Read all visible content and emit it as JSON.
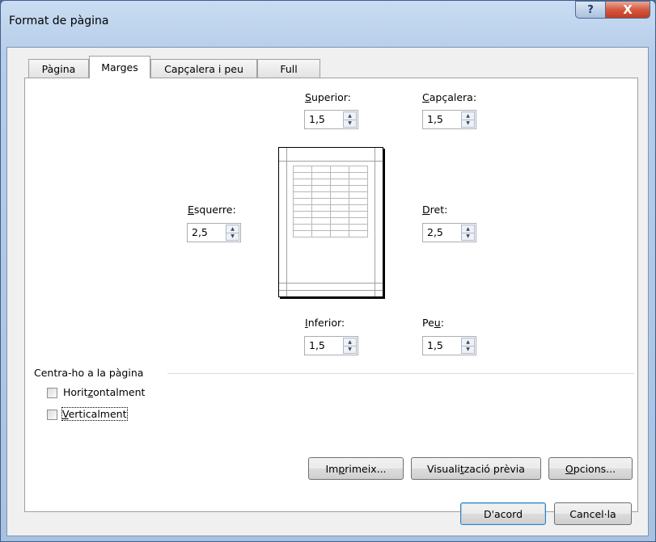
{
  "window": {
    "title": "Format de pàgina",
    "help_label": "?",
    "close_label": "X"
  },
  "tabs": [
    {
      "label": "Pàgina",
      "active": false
    },
    {
      "label": "Marges",
      "active": true
    },
    {
      "label": "Capçalera i peu",
      "active": false
    },
    {
      "label": "Full",
      "active": false
    }
  ],
  "margins": {
    "top": {
      "pre": "",
      "key": "S",
      "post": "uperior:",
      "value": "1,5"
    },
    "header": {
      "pre": "",
      "key": "C",
      "post": "apçalera:",
      "value": "1,5"
    },
    "left": {
      "pre": "",
      "key": "E",
      "post": "squerre:",
      "value": "2,5"
    },
    "right": {
      "pre": "",
      "key": "D",
      "post": "ret:",
      "value": "2,5"
    },
    "bottom": {
      "pre": "",
      "key": "I",
      "post": "nferior:",
      "value": "1,5"
    },
    "footer": {
      "pre": "Pe",
      "key": "u",
      "post": ":",
      "value": "1,5"
    }
  },
  "center": {
    "group_label": "Centra-ho a la pàgina",
    "horizontally": {
      "pre": "Horit",
      "key": "z",
      "post": "ontalment",
      "checked": false
    },
    "vertically": {
      "pre": "",
      "key": "V",
      "post": "erticalment",
      "checked": false
    }
  },
  "buttons": {
    "print": {
      "pre": "Im",
      "key": "p",
      "post": "rimeix..."
    },
    "preview": {
      "pre": "Visuali",
      "key": "t",
      "post": "zació prèvia"
    },
    "options": {
      "pre": "",
      "key": "O",
      "post": "pcions..."
    },
    "ok": "D'acord",
    "cancel": "Cancel·la"
  }
}
